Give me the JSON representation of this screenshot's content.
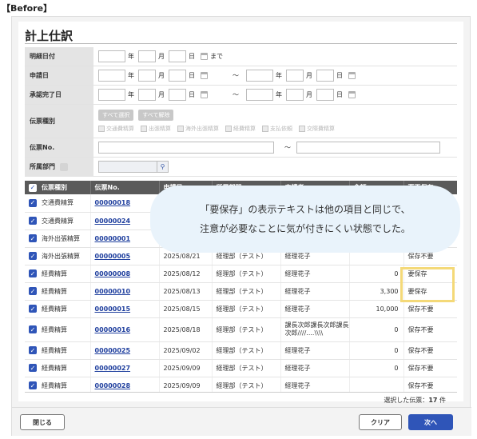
{
  "before_label": "【Before】",
  "page_title": "計上仕訳",
  "form": {
    "meisai_date": {
      "label": "明細日付",
      "year_unit": "年",
      "month_unit": "月",
      "day_unit": "日",
      "suffix": "まで"
    },
    "apply_date": {
      "label": "申請日",
      "year_unit": "年",
      "month_unit": "月",
      "day_unit": "日",
      "tilde": "～"
    },
    "approve_date": {
      "label": "承認完了日",
      "year_unit": "年",
      "month_unit": "月",
      "day_unit": "日",
      "tilde": "～"
    },
    "slip_type": {
      "label": "伝票種別",
      "select_all": "すべて選択",
      "clear_all": "すべて解除",
      "options": [
        "交通費精算",
        "出張精算",
        "海外出張精算",
        "経費精算",
        "支払依頼",
        "交際費精算"
      ]
    },
    "slip_no": {
      "label": "伝票No.",
      "tilde": "～"
    },
    "department": {
      "label": "所属部門",
      "search_icon": "search-icon"
    }
  },
  "table": {
    "headers": [
      "伝票種別",
      "伝票No.",
      "申請日",
      "所属部門",
      "申請者",
      "金額",
      "要否保存"
    ],
    "rows": [
      {
        "type": "交通費精算",
        "no": "00000018",
        "date": "",
        "dept": "",
        "applicant": "",
        "amount": "",
        "status": ""
      },
      {
        "type": "交通費精算",
        "no": "00000024",
        "date": "",
        "dept": "",
        "applicant": "",
        "amount": "",
        "status": ""
      },
      {
        "type": "海外出張精算",
        "no": "00000001",
        "date": "",
        "dept": "",
        "applicant": "",
        "amount": "",
        "status": ""
      },
      {
        "type": "海外出張精算",
        "no": "00000005",
        "date": "2025/08/21",
        "dept": "経理部（テスト）",
        "applicant": "経理花子",
        "amount": "",
        "status": "保存不要"
      },
      {
        "type": "経費精算",
        "no": "00000008",
        "date": "2025/08/12",
        "dept": "経理部（テスト）",
        "applicant": "経理花子",
        "amount": "0",
        "status": "要保存"
      },
      {
        "type": "経費精算",
        "no": "00000010",
        "date": "2025/08/13",
        "dept": "経理部（テスト）",
        "applicant": "経理花子",
        "amount": "3,300",
        "status": "要保存"
      },
      {
        "type": "経費精算",
        "no": "00000015",
        "date": "2025/08/15",
        "dept": "経理部（テスト）",
        "applicant": "経理花子",
        "amount": "10,000",
        "status": "保存不要"
      },
      {
        "type": "経費精算",
        "no": "00000016",
        "date": "2025/08/18",
        "dept": "経理部（テスト）",
        "applicant": "課長次郎課長次郎課長次郎////....\\\\\\\\",
        "amount": "0",
        "status": "保存不要"
      },
      {
        "type": "経費精算",
        "no": "00000025",
        "date": "2025/09/02",
        "dept": "経理部（テスト）",
        "applicant": "経理花子",
        "amount": "0",
        "status": "保存不要"
      },
      {
        "type": "経費精算",
        "no": "00000027",
        "date": "2025/09/09",
        "dept": "経理部（テスト）",
        "applicant": "経理花子",
        "amount": "0",
        "status": "保存不要"
      },
      {
        "type": "経費精算",
        "no": "00000028",
        "date": "2025/09/09",
        "dept": "経理部（テスト）",
        "applicant": "経理花子",
        "amount": "",
        "status": "保存不要"
      }
    ]
  },
  "summary": {
    "label": "選択した伝票：",
    "count": "17",
    "unit": "件"
  },
  "buttons": {
    "close": "閉じる",
    "clear": "クリア",
    "next": "次へ"
  },
  "callout": {
    "line1": "「要保存」の表示テキストは他の項目と同じで、",
    "line2": "注意が必要なことに気が付きにくい状態でした。"
  },
  "colors": {
    "accent": "#2f55b8",
    "highlight": "#f4d978",
    "callout_bg": "#e9f3fb"
  }
}
